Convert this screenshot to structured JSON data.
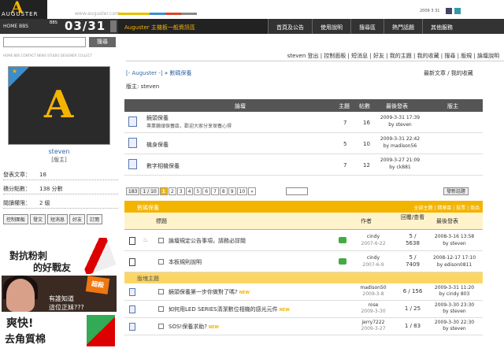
{
  "header": {
    "logo_letter": "A",
    "logo_word": "AUGUSTER",
    "url": "www.auguster.com",
    "nav_label": "HOME BBS",
    "date_sec": "BBS",
    "date_num": "03/31",
    "forum_title": "Auguster 主機板一般資訊區",
    "top_right_text": "2009 3 31",
    "nav_items": [
      "首頁及公告",
      "使用說明",
      "搜尋區",
      "熱門話題",
      "其他服務"
    ]
  },
  "search": {
    "button_label": "搜尋"
  },
  "tiny_line": "HOME BBS CONTACT NEWS STUDIO DESIGNER COLLECT",
  "user_strip": "steven 登出 | 控制面板 | 短消息 | 好友 | 我的主題 | 我的收藏 | 搜尋 | 版規 | 論壇說明",
  "profile": {
    "avatar_letter": "A",
    "username": "steven",
    "role": "[版主]",
    "stats": [
      {
        "label": "發表文章：",
        "value": "18"
      },
      {
        "label": "積分點數：",
        "value": "138 分數"
      },
      {
        "label": "閱讀權限：",
        "value": "2 級"
      }
    ],
    "buttons": [
      "控制面板",
      "發文",
      "短消息",
      "好友",
      "訂閱"
    ]
  },
  "ads": {
    "ad1_line1": "對抗粉刺",
    "ad1_line2": "的好戰友",
    "ad2_question": "有誰知道\n這位正妹???",
    "ad2_sticker": "超殺",
    "ad3_line1": "爽快!",
    "ad3_line2": "去角質棉"
  },
  "breadcrumb": {
    "root": "[- Auguster -]",
    "sep": "»",
    "current": "數碼保養"
  },
  "breadcrumb_right": "最新文章 / 我的收藏",
  "moderators": "版主: steven",
  "subforum_table": {
    "headers": {
      "forum": "論壇",
      "topics": "主題",
      "posts": "帖數",
      "last_post": "最後發表",
      "moderator": "版主"
    },
    "rows": [
      {
        "name": "鏡頭保養",
        "desc": "專業鏡頭保養區，歡迎大家分享保養心得",
        "topics": "7",
        "posts": "16",
        "last_date": "2009-3-31 17:39",
        "last_by": "by steven"
      },
      {
        "name": "機身保養",
        "desc": "",
        "topics": "5",
        "posts": "10",
        "last_date": "2009-3-31 22:42",
        "last_by": "by madison56"
      },
      {
        "name": "數字相機保養",
        "desc": "",
        "topics": "7",
        "posts": "12",
        "last_date": "2009-3-27 21:09",
        "last_by": "by ck881"
      }
    ]
  },
  "pager": {
    "total": "183",
    "pages_of": "1 / 10",
    "pages": [
      "1",
      "2",
      "3",
      "4",
      "5",
      "6",
      "7",
      "8",
      "9",
      "10",
      "»"
    ],
    "new_topic": "發新話題"
  },
  "topic_table": {
    "title": "數碼保養",
    "right_links": "全部主題 | 精華區 | 投票 | 商品",
    "headers": {
      "subject": "標題",
      "author": "作者",
      "replies": "回覆/查看",
      "last_post": "最後發表"
    },
    "pinned": [
      {
        "subject": "論壇規定公告事項，請務必詳閱",
        "author": "cindy",
        "date": "2007-6-22",
        "replies": "5 /",
        "views": "5638",
        "last_date": "2008-3-16 13:58",
        "last_by": "by steven"
      },
      {
        "subject": "本板規則說明",
        "author": "cindy",
        "date": "2007-6-9",
        "replies": "5 /",
        "views": "7409",
        "last_date": "2008-12-17 17:10",
        "last_by": "by edison0811"
      }
    ],
    "section_label": "版塊主題",
    "topics": [
      {
        "subject": "鏡頭保養第一步你做對了嗎?",
        "newtag": "NEW",
        "author": "madison50",
        "date": "2009-3-8",
        "replies": "6 / 156",
        "last_date": "2009-3-31 11:20",
        "last_by": "by cindy 803"
      },
      {
        "subject": "如何用LED SERIES清潔數位相機的感光元件",
        "newtag": "NEW",
        "author": "rose",
        "date": "2009-3-30",
        "replies": "1 / 25",
        "last_date": "2009-3-30 23:30",
        "last_by": "by steven"
      },
      {
        "subject": "SOS!保養求助?",
        "newtag": "NEW",
        "author": "jerry7222",
        "date": "2009-3-27",
        "replies": "1 / 83",
        "last_date": "2009-3-30 22:30",
        "last_by": "by steven"
      }
    ]
  }
}
